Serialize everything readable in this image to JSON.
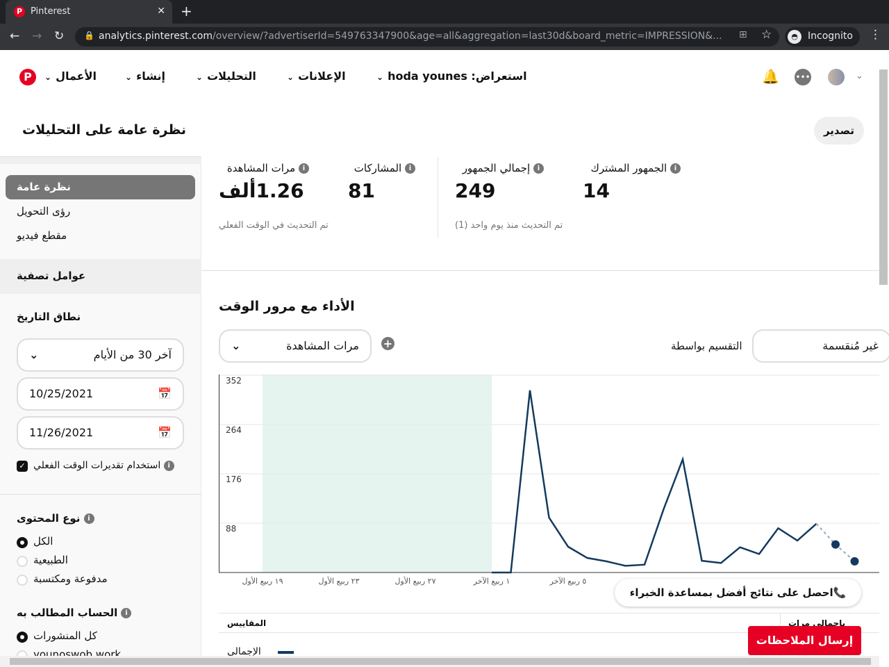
{
  "browser": {
    "tab_title": "Pinterest",
    "url_host": "analytics.pinterest.com",
    "url_path": "/overview/?advertiserId=549763347900&age=all&aggregation=last30d&board_metric=IMPRESSION&...",
    "profile": "Incognito"
  },
  "nav": {
    "business": "الأعمال",
    "create": "إنشاء",
    "analytics": "التحليلات",
    "ads": "الإعلانات",
    "account": "استعراض: hoda younes"
  },
  "header": {
    "title": "نظرة عامة على التحليلات",
    "export": "تصدير"
  },
  "sidebar": {
    "items": [
      {
        "label": "نظرة عامة"
      },
      {
        "label": "رؤى التحويل"
      },
      {
        "label": "مقطع فيديو"
      }
    ],
    "filters_title": "عوامل تصفية",
    "date_range_title": "نطاق التاريخ",
    "date_preset": "آخر 30 من الأيام",
    "start_date": "10/25/2021",
    "end_date": "11/26/2021",
    "realtime_label": "استخدام تقديرات الوقت الفعلي",
    "content_type_title": "نوع المحتوى",
    "content_types": [
      "الكل",
      "الطبيعية",
      "مدفوعة ومكتسبة"
    ],
    "claimed_title": "الحساب المطالب به",
    "claimed": [
      "كل المنشورات",
      "younoswob work"
    ]
  },
  "stats": {
    "impressions_label": "مرات المشاهدة",
    "impressions": "1.26ألف",
    "engagements_label": "المشاركات",
    "engagements": "81",
    "realtime_note": "تم التحديث في الوقت الفعلي",
    "audience_label": "إجمالي الجمهور",
    "audience": "249",
    "engaged_label": "الجمهور المشترك",
    "engaged": "14",
    "daily_note": "تم التحديث منذ يوم واحد (1)"
  },
  "performance": {
    "title": "الأداء مع مرور الوقت",
    "metric": "مرات المشاهدة",
    "split_label": "التقسيم بواسطة",
    "split_value": "غير مُنقسمة",
    "expert": "احصل على نتائج أفضل بمساعدة الخبراء",
    "table_metrics": "المقاييس",
    "table_total": "بإجمالي مرات",
    "legend_total": "الإجمالي"
  },
  "feedback": "إرسال الملاحظات",
  "chart_data": {
    "type": "line",
    "title": "الأداء مع مرور الوقت",
    "ylabel": "مرات المشاهدة",
    "ylim": [
      0,
      352
    ],
    "yticks": [
      "88",
      "176",
      "264",
      "352"
    ],
    "xticks": [
      {
        "day": 0,
        "label": "١٩ ربيع الأول"
      },
      {
        "day": 4,
        "label": "٢٣ ربيع الأول"
      },
      {
        "day": 8,
        "label": "٢٧ ربيع الأول"
      },
      {
        "day": 12,
        "label": "١ ربيع الآخر"
      },
      {
        "day": 16,
        "label": "٥ ربيع الآخر"
      }
    ],
    "shaded_days": [
      0,
      12
    ],
    "series": [
      {
        "name": "الإجمالي",
        "color": "#133a5e",
        "days": [
          12,
          13,
          14,
          15,
          16,
          17,
          18,
          19,
          20,
          21,
          22,
          23,
          24,
          25,
          26,
          27,
          28,
          29
        ],
        "values": [
          0,
          0,
          325,
          98,
          46,
          26,
          20,
          12,
          14,
          113,
          202,
          21,
          17,
          45,
          33,
          79,
          57,
          87
        ]
      },
      {
        "name": "estimate",
        "color": "#9aa8b8",
        "dashed": true,
        "days": [
          29,
          30,
          31
        ],
        "values": [
          87,
          50,
          20
        ]
      }
    ]
  }
}
